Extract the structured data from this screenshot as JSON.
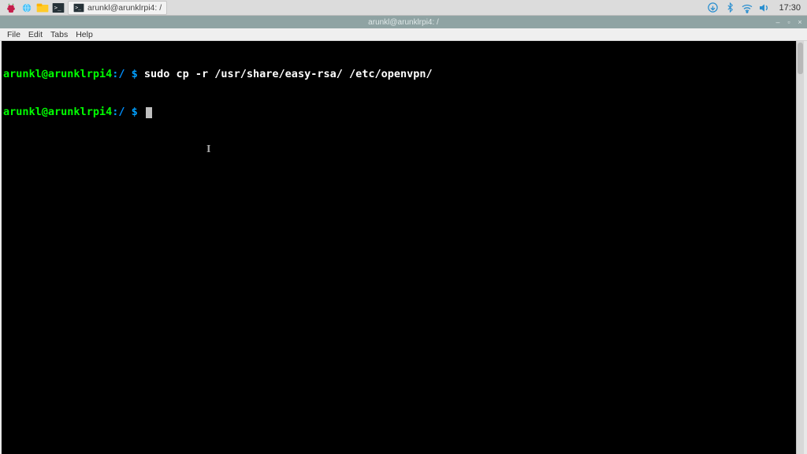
{
  "panel": {
    "taskbar_item_label": "arunkl@arunklrpi4: /",
    "clock": "17:30"
  },
  "window": {
    "title": "arunkl@arunklrpi4: /"
  },
  "menu": {
    "file": "File",
    "edit": "Edit",
    "tabs": "Tabs",
    "help": "Help"
  },
  "terminal": {
    "lines": [
      {
        "user": "arunkl",
        "at": "@",
        "host": "arunklrpi4",
        "colon": ":",
        "path": "/",
        "dollar": " $ ",
        "cmd": "sudo cp -r /usr/share/easy-rsa/ /etc/openvpn/"
      },
      {
        "user": "arunkl",
        "at": "@",
        "host": "arunklrpi4",
        "colon": ":",
        "path": "/",
        "dollar": " $ ",
        "cmd": ""
      }
    ]
  }
}
